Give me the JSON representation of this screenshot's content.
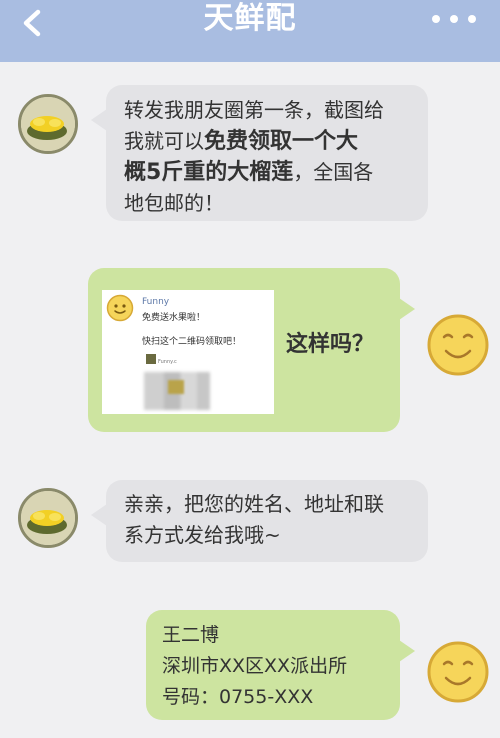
{
  "header": {
    "title": "天鲜配"
  },
  "messages": {
    "m1": {
      "line1": "转发我朋友圈第一条，截图给",
      "line2_pre": "我就可以",
      "line2_hl": "免费领取一个大",
      "line3_hl": "概5斤重的大榴莲",
      "line3_post": "，全国各",
      "line4": "地包邮的！"
    },
    "m2": {
      "card": {
        "name": "Funny",
        "line1": "免费送水果啦！",
        "line2": "快扫这个二维码领取吧！",
        "subname": "Funny.c"
      },
      "question": "这样吗？"
    },
    "m3": {
      "line1": "亲亲，把您的姓名、地址和联",
      "line2": "系方式发给我哦~"
    },
    "m4": {
      "line1": "王二博",
      "line2": "深圳市XX区XX派出所",
      "line3": "号码：0755-XXX"
    }
  },
  "colors": {
    "header": "#a9bde1",
    "incoming_bubble": "#e3e3e6",
    "outgoing_bubble": "#cde4a0",
    "smiley": "#f6d55a"
  },
  "icons": {
    "back": "chevron-left-icon",
    "more": "more-dots-icon",
    "seller_avatar": "durian-avatar",
    "user_avatar": "smiley-face-icon"
  }
}
